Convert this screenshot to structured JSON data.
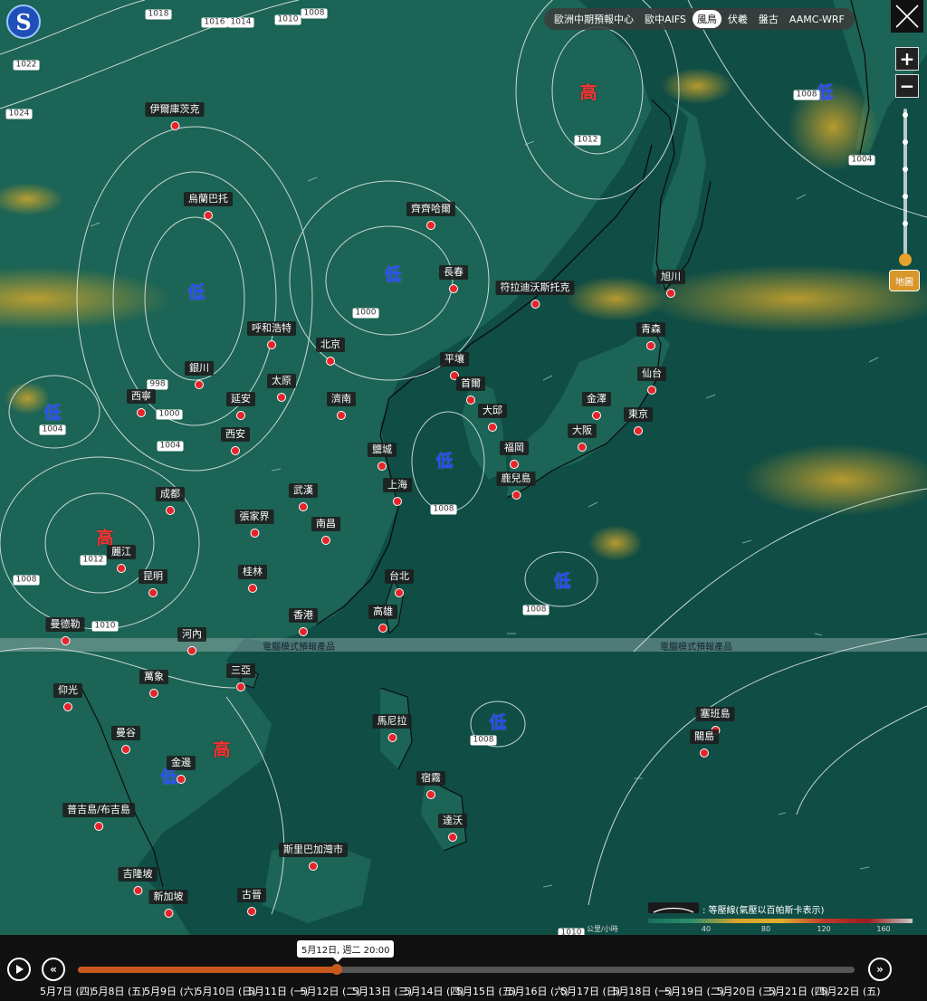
{
  "toolbar": {
    "tabs": [
      "歐洲中期預報中心",
      "歐中AIFS",
      "風鳥",
      "伏羲",
      "盤古",
      "AAMC-WRF"
    ],
    "active_tab": "風鳥"
  },
  "zoom": {
    "in_label": "+",
    "out_label": "−"
  },
  "map_button": "地圖",
  "watermark": "電腦模式預報產品",
  "pressure_systems": [
    {
      "label": "高",
      "kind": "high"
    },
    {
      "label": "低",
      "kind": "low"
    }
  ],
  "cities": [
    "伊爾庫茨克",
    "烏蘭巴托",
    "齊齊哈爾",
    "長春",
    "符拉迪沃斯托克",
    "旭川",
    "呼和浩特",
    "北京",
    "平壤",
    "首爾",
    "青森",
    "銀川",
    "太原",
    "西寧",
    "延安",
    "濟南",
    "大邱",
    "仙台",
    "金澤",
    "東京",
    "西安",
    "大阪",
    "鹽城",
    "福岡",
    "上海",
    "鹿兒島",
    "成都",
    "武漢",
    "張家界",
    "南昌",
    "麗江",
    "昆明",
    "桂林",
    "台北",
    "曼德勒",
    "香港",
    "高雄",
    "河內",
    "三亞",
    "仰光",
    "萬象",
    "塞班島",
    "馬尼拉",
    "關島",
    "曼谷",
    "金邊",
    "宿霧",
    "普吉島/布吉島",
    "達沃",
    "斯里巴加灣市",
    "吉隆坡",
    "新加坡",
    "古晉"
  ],
  "isobars": [
    "1018",
    "1016",
    "1014",
    "1010",
    "1008",
    "1022",
    "1024",
    "1012",
    "1008",
    "1004",
    "1000",
    "998",
    "1000",
    "1004",
    "1008",
    "1012",
    "1010",
    "1008",
    "1008",
    "1008",
    "1008",
    "1004",
    "1010",
    "1008"
  ],
  "legend": {
    "isobar_text": ": 等壓線(氣壓以百帕斯卡表示)",
    "unit": "公里/小時",
    "ticks": [
      "40",
      "80",
      "120",
      "160"
    ]
  },
  "timeline": {
    "current_label": "5月12日, 週二 20:00",
    "days": [
      "5月7日 (四)",
      "5月8日 (五)",
      "5月9日 (六)",
      "5月10日 (日)",
      "5月11日 (一)",
      "5月12日 (二)",
      "5月13日 (三)",
      "5月14日 (四)",
      "5月15日 (五)",
      "5月16日 (六)",
      "5月17日 (日)",
      "5月18日 (一)",
      "5月19日 (二)",
      "5月20日 (三)",
      "5月21日 (四)",
      "5月22日 (五)"
    ]
  },
  "colors": {
    "ocean": "#0d4d44",
    "land": "#1f6a5a",
    "wind_yellow": "#c9a52a",
    "city_dot": "#e5252a",
    "high": "#ff3030",
    "low": "#2b4cff",
    "timeline_fill": "#c8581e"
  }
}
